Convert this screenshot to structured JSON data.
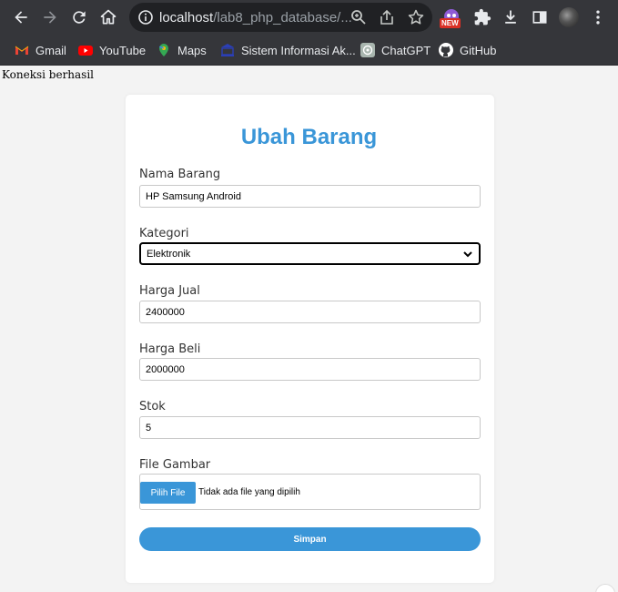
{
  "browser": {
    "url_host": "localhost",
    "url_path": "/lab8_php_database/...",
    "extension_badge": "NEW",
    "bookmarks": [
      {
        "label": "Gmail"
      },
      {
        "label": "YouTube"
      },
      {
        "label": "Maps"
      },
      {
        "label": "Sistem Informasi Ak..."
      },
      {
        "label": "ChatGPT"
      },
      {
        "label": "GitHub"
      }
    ]
  },
  "page": {
    "status": "Koneksi berhasil",
    "title": "Ubah Barang",
    "form": {
      "nama_label": "Nama Barang",
      "nama_value": "HP Samsung Android",
      "kategori_label": "Kategori",
      "kategori_value": "Elektronik",
      "harga_jual_label": "Harga Jual",
      "harga_jual_value": "2400000",
      "harga_beli_label": "Harga Beli",
      "harga_beli_value": "2000000",
      "stok_label": "Stok",
      "stok_value": "5",
      "gambar_label": "File Gambar",
      "file_button": "Pilih File",
      "file_status": "Tidak ada file yang dipilih",
      "submit_label": "Simpan"
    }
  },
  "colors": {
    "accent": "#3a96d8",
    "chrome_bg": "#35363a",
    "page_bg": "#f3f3f3"
  }
}
